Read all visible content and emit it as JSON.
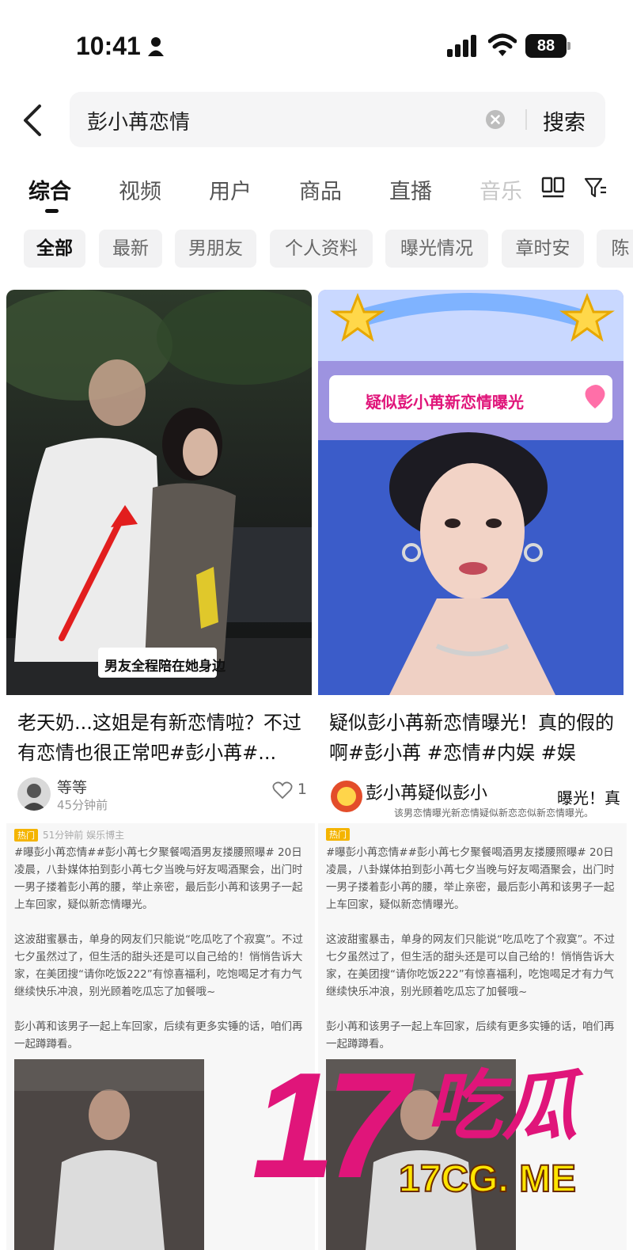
{
  "status_bar": {
    "time": "10:41",
    "battery": "88"
  },
  "search": {
    "query": "彭小苒恋情",
    "submit_label": "搜索"
  },
  "tabs": [
    {
      "label": "综合"
    },
    {
      "label": "视频"
    },
    {
      "label": "用户"
    },
    {
      "label": "商品"
    },
    {
      "label": "直播"
    },
    {
      "label": "音乐"
    }
  ],
  "chips": [
    {
      "label": "全部"
    },
    {
      "label": "最新"
    },
    {
      "label": "男朋友"
    },
    {
      "label": "个人资料"
    },
    {
      "label": "曝光情况"
    },
    {
      "label": "章时安"
    },
    {
      "label": "陈"
    }
  ],
  "cards": [
    {
      "image_caption": "男友全程陪在她身边",
      "title": "老天奶...这姐是有新恋情啦？不过有恋情也很正常吧#彭小苒#...",
      "author": "等等",
      "time": "45分钟前",
      "likes": "1"
    },
    {
      "image_banner": "疑似彭小苒新恋情曝光",
      "title": "疑似彭小苒新恋情曝光！真的假的啊#彭小苒 #恋情#内娱 #娱",
      "overlay_text": "彭小苒疑似彭小",
      "overlay_text2": "曝光！真",
      "overlay_sub": "该男恋情曝光新恋情疑似新恋恋似新恋情曝光。"
    }
  ],
  "posts": [
    {
      "meta": "51分钟前 娱乐博主",
      "tag": "热门",
      "paragraphs": [
        "#曝彭小苒恋情##彭小苒七夕聚餐喝酒男友搂腰照曝# 20日凌晨，八卦媒体拍到彭小苒七夕当晚与好友喝酒聚会，出门时一男子搂着彭小苒的腰，举止亲密，最后彭小苒和该男子一起上车回家，疑似新恋情曝光。",
        "这波甜蜜暴击，单身的网友们只能说“吃瓜吃了个寂寞”。不过七夕虽然过了，但生活的甜头还是可以自己给的！悄悄告诉大家，在美团搜“请你吃饭222”有惊喜福利，吃饱喝足才有力气继续快乐冲浪，别光顾着吃瓜忘了加餐哦~",
        "彭小苒和该男子一起上车回家，后续有更多实锤的话，咱们再一起蹲蹲看。"
      ]
    },
    {
      "meta": "",
      "tag": "热门",
      "paragraphs": [
        "#曝彭小苒恋情##彭小苒七夕聚餐喝酒男友搂腰照曝# 20日凌晨，八卦媒体拍到彭小苒七夕当晚与好友喝酒聚会，出门时一男子搂着彭小苒的腰，举止亲密，最后彭小苒和该男子一起上车回家，疑似新恋情曝光。",
        "这波甜蜜暴击，单身的网友们只能说“吃瓜吃了个寂寞”。不过七夕虽然过了，但生活的甜头还是可以自己给的！悄悄告诉大家，在美团搜“请你吃饭222”有惊喜福利，吃饱喝足才有力气继续快乐冲浪，别光顾着吃瓜忘了加餐哦~",
        "彭小苒和该男子一起上车回家，后续有更多实锤的话，咱们再一起蹲蹲看。"
      ]
    }
  ],
  "watermark": {
    "big": "17",
    "cn": "吃瓜",
    "domain": "17CG. ME"
  },
  "colors": {
    "accent": "#e0157a",
    "watermark_yellow": "#ffe500",
    "banner_purple": "#9d93e0"
  }
}
